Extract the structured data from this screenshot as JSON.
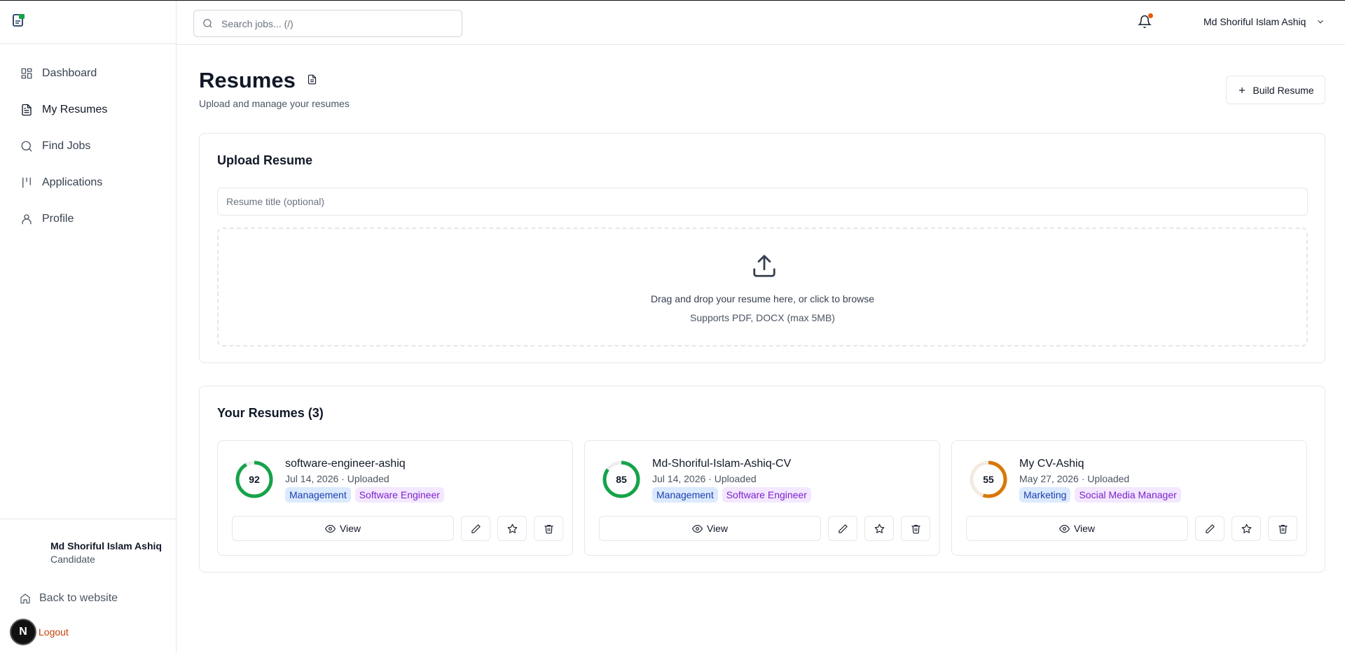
{
  "sidebar": {
    "items": [
      {
        "label": "Dashboard",
        "icon": "grid-icon"
      },
      {
        "label": "My Resumes",
        "icon": "file-icon",
        "active": true
      },
      {
        "label": "Find Jobs",
        "icon": "search-icon"
      },
      {
        "label": "Applications",
        "icon": "kanban-icon"
      },
      {
        "label": "Profile",
        "icon": "user-icon"
      }
    ],
    "user": {
      "name": "Md Shoriful Islam Ashiq",
      "role": "Candidate"
    },
    "back_label": "Back to website",
    "logout_label": "Logout",
    "badge_letter": "N"
  },
  "topbar": {
    "search_placeholder": "Search jobs... (/)",
    "user_name": "Md Shoriful Islam Ashiq",
    "notification_dot_color": "#ea580c"
  },
  "page": {
    "title": "Resumes",
    "subtitle": "Upload and manage your resumes",
    "build_label": "Build Resume"
  },
  "upload": {
    "title": "Upload Resume",
    "title_placeholder": "Resume title (optional)",
    "drop_text": "Drag and drop your resume here, or click to browse",
    "support_text": "Supports PDF, DOCX (max 5MB)"
  },
  "resumes": {
    "title": "Your Resumes (3)",
    "view_label": "View",
    "items": [
      {
        "name": "software-engineer-ashiq",
        "meta": "Jul 14, 2026 · Uploaded",
        "score": 92,
        "score_color": "#16a34a",
        "tags": [
          "Management",
          "Software Engineer"
        ]
      },
      {
        "name": "Md-Shoriful-Islam-Ashiq-CV",
        "meta": "Jul 14, 2026 · Uploaded",
        "score": 85,
        "score_color": "#16a34a",
        "tags": [
          "Management",
          "Software Engineer"
        ]
      },
      {
        "name": "My CV-Ashiq",
        "meta": "May 27, 2026 · Uploaded",
        "score": 55,
        "score_color": "#d97706",
        "tags": [
          "Marketing",
          "Social Media Manager"
        ]
      }
    ]
  }
}
